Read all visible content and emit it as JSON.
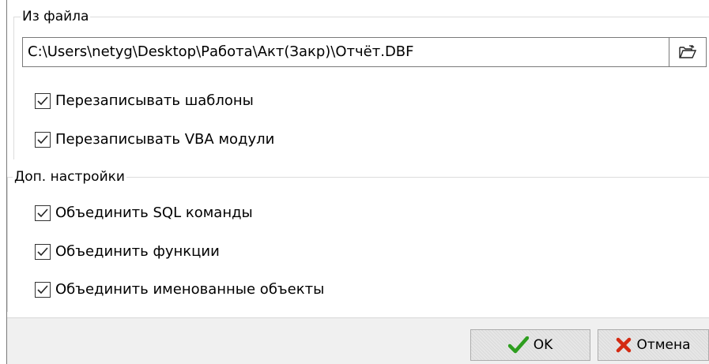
{
  "from_file": {
    "legend": "Из файла",
    "path_value": "C:\\Users\\netyg\\Desktop\\Работа\\Акт(Закр)\\Отчёт.DBF",
    "browse_icon": "folder-open-icon",
    "options": [
      {
        "label": "Перезаписывать шаблоны",
        "checked": true
      },
      {
        "label": "Перезаписывать VBA модули",
        "checked": true
      }
    ]
  },
  "extra_settings": {
    "legend": "Доп. настройки",
    "options": [
      {
        "label": "Объединить SQL команды",
        "checked": true
      },
      {
        "label": "Объединить функции",
        "checked": true
      },
      {
        "label": "Объединить именованные объекты",
        "checked": true
      }
    ]
  },
  "buttons": {
    "ok_label": "OK",
    "ok_icon": "checkmark-icon",
    "cancel_label": "Отмена",
    "cancel_icon": "cross-icon"
  },
  "colors": {
    "ok_icon": "#2e9e1f",
    "cancel_icon": "#d42a12",
    "footer_bg": "#f0f0f0",
    "border": "#7a7a7a"
  }
}
